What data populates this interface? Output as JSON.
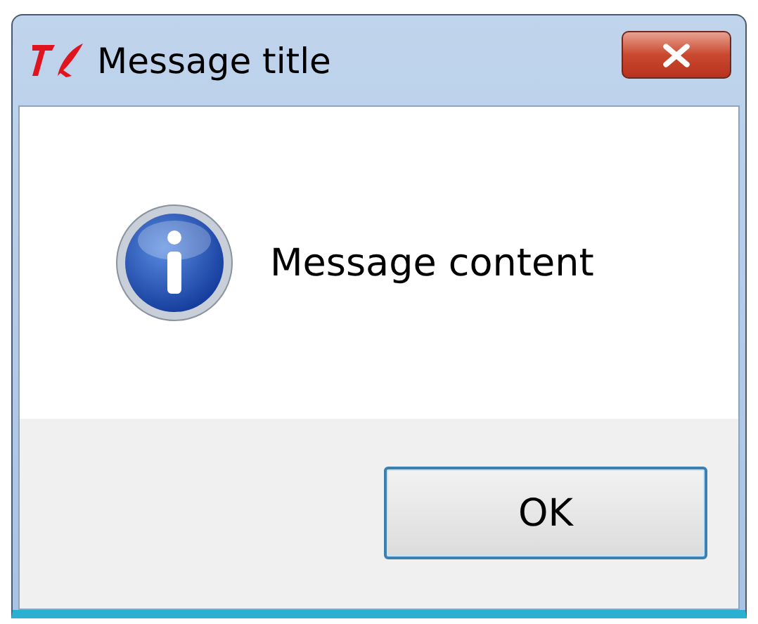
{
  "window": {
    "title": "Message title"
  },
  "message": {
    "kind": "info",
    "text": "Message content"
  },
  "buttons": [
    {
      "label": "OK",
      "default": true
    }
  ]
}
